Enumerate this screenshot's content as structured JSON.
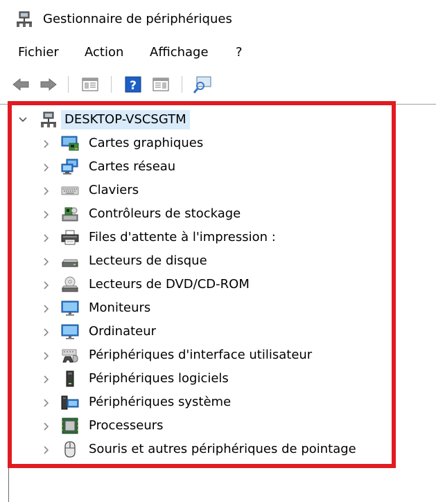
{
  "window": {
    "title": "Gestionnaire de périphériques"
  },
  "menu": [
    {
      "label": "Fichier"
    },
    {
      "label": "Action"
    },
    {
      "label": "Affichage"
    },
    {
      "label": "?"
    }
  ],
  "toolbar": [
    {
      "icon": "back-arrow-icon"
    },
    {
      "icon": "forward-arrow-icon"
    },
    {
      "icon": "show-hide-console-tree-icon"
    },
    {
      "icon": "help-icon"
    },
    {
      "icon": "action-pane-icon"
    },
    {
      "icon": "scan-hardware-changes-icon"
    }
  ],
  "tree": {
    "root": {
      "label": "DESKTOP-VSCSGTM",
      "icon": "computer-network-icon",
      "expanded": true
    },
    "items": [
      {
        "label": "Cartes graphiques",
        "icon": "display-adapter-icon"
      },
      {
        "label": "Cartes réseau",
        "icon": "network-adapter-icon"
      },
      {
        "label": "Claviers",
        "icon": "keyboard-icon"
      },
      {
        "label": "Contrôleurs de stockage",
        "icon": "storage-controller-icon"
      },
      {
        "label": "Files d'attente à l'impression :",
        "icon": "printer-icon"
      },
      {
        "label": "Lecteurs de disque",
        "icon": "disk-drive-icon"
      },
      {
        "label": "Lecteurs de DVD/CD-ROM",
        "icon": "dvd-drive-icon"
      },
      {
        "label": "Moniteurs",
        "icon": "monitor-icon"
      },
      {
        "label": "Ordinateur",
        "icon": "computer-icon"
      },
      {
        "label": "Périphériques d'interface utilisateur",
        "icon": "hid-icon"
      },
      {
        "label": "Périphériques logiciels",
        "icon": "software-device-icon"
      },
      {
        "label": "Périphériques système",
        "icon": "system-device-icon"
      },
      {
        "label": "Processeurs",
        "icon": "processor-icon"
      },
      {
        "label": "Souris et autres périphériques de pointage",
        "icon": "mouse-icon"
      }
    ]
  },
  "colors": {
    "highlight_border": "#e11b22",
    "root_selection": "#d9ebfa",
    "accent_blue": "#1e7bd6"
  }
}
